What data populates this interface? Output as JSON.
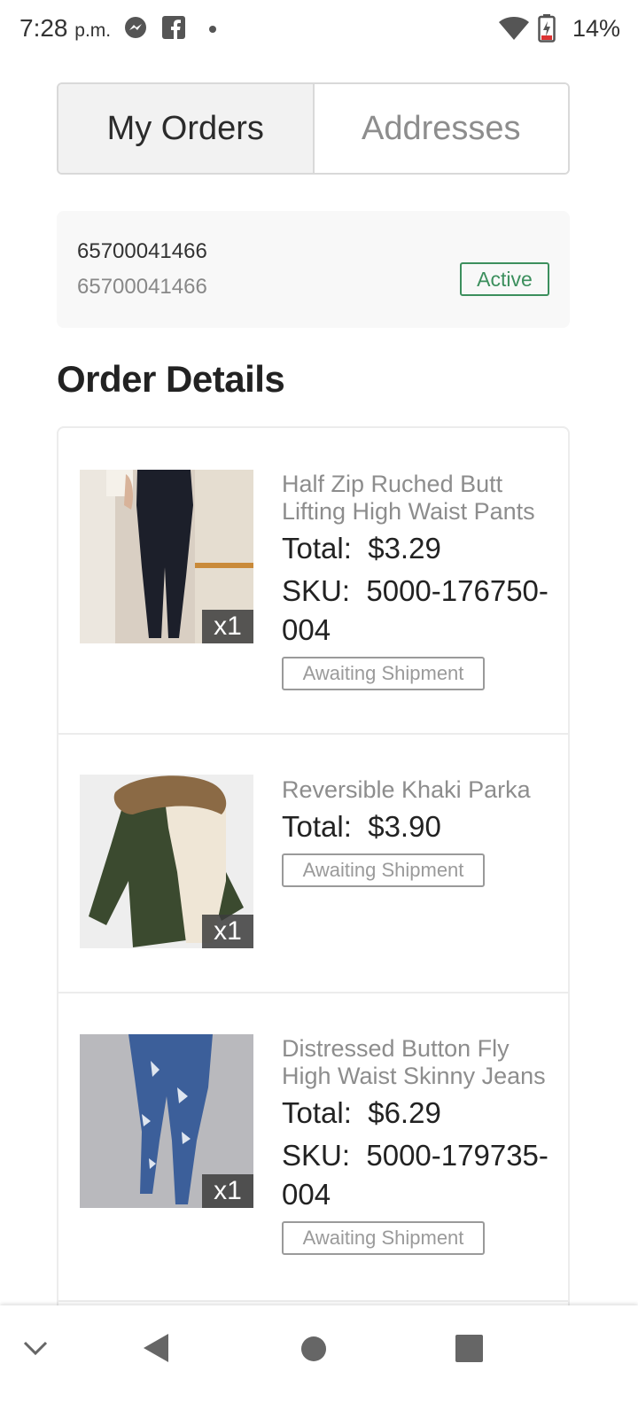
{
  "status_bar": {
    "time": "7:28",
    "ampm": "p.m.",
    "battery": "14%"
  },
  "tabs": [
    {
      "label": "My Orders",
      "active": true
    },
    {
      "label": "Addresses",
      "active": false
    }
  ],
  "order": {
    "number": "65700041466",
    "sub_number": "65700041466",
    "status": "Active"
  },
  "section_title": "Order Details",
  "items": [
    {
      "title": "Half Zip Ruched Butt Lifting High Waist Pants",
      "total_label": "Total:",
      "total": "$3.29",
      "sku_label": "SKU:",
      "sku": "5000-176750-004",
      "quantity": "x1",
      "status": "Awaiting Shipment"
    },
    {
      "title": "Reversible Khaki Parka",
      "total_label": "Total:",
      "total": "$3.90",
      "quantity": "x1",
      "status": "Awaiting Shipment"
    },
    {
      "title": "Distressed Button Fly High Waist Skinny Jeans",
      "total_label": "Total:",
      "total": "$6.29",
      "sku_label": "SKU:",
      "sku": "5000-179735-004",
      "quantity": "x1",
      "status": "Awaiting Shipment"
    }
  ],
  "colors": {
    "active_green": "#3c8f5d",
    "muted_gray": "#8d8d8d"
  },
  "icons": [
    "messenger-icon",
    "facebook-icon",
    "wifi-icon",
    "battery-icon",
    "nav-down-icon",
    "nav-back-icon",
    "nav-home-icon",
    "nav-recents-icon"
  ]
}
